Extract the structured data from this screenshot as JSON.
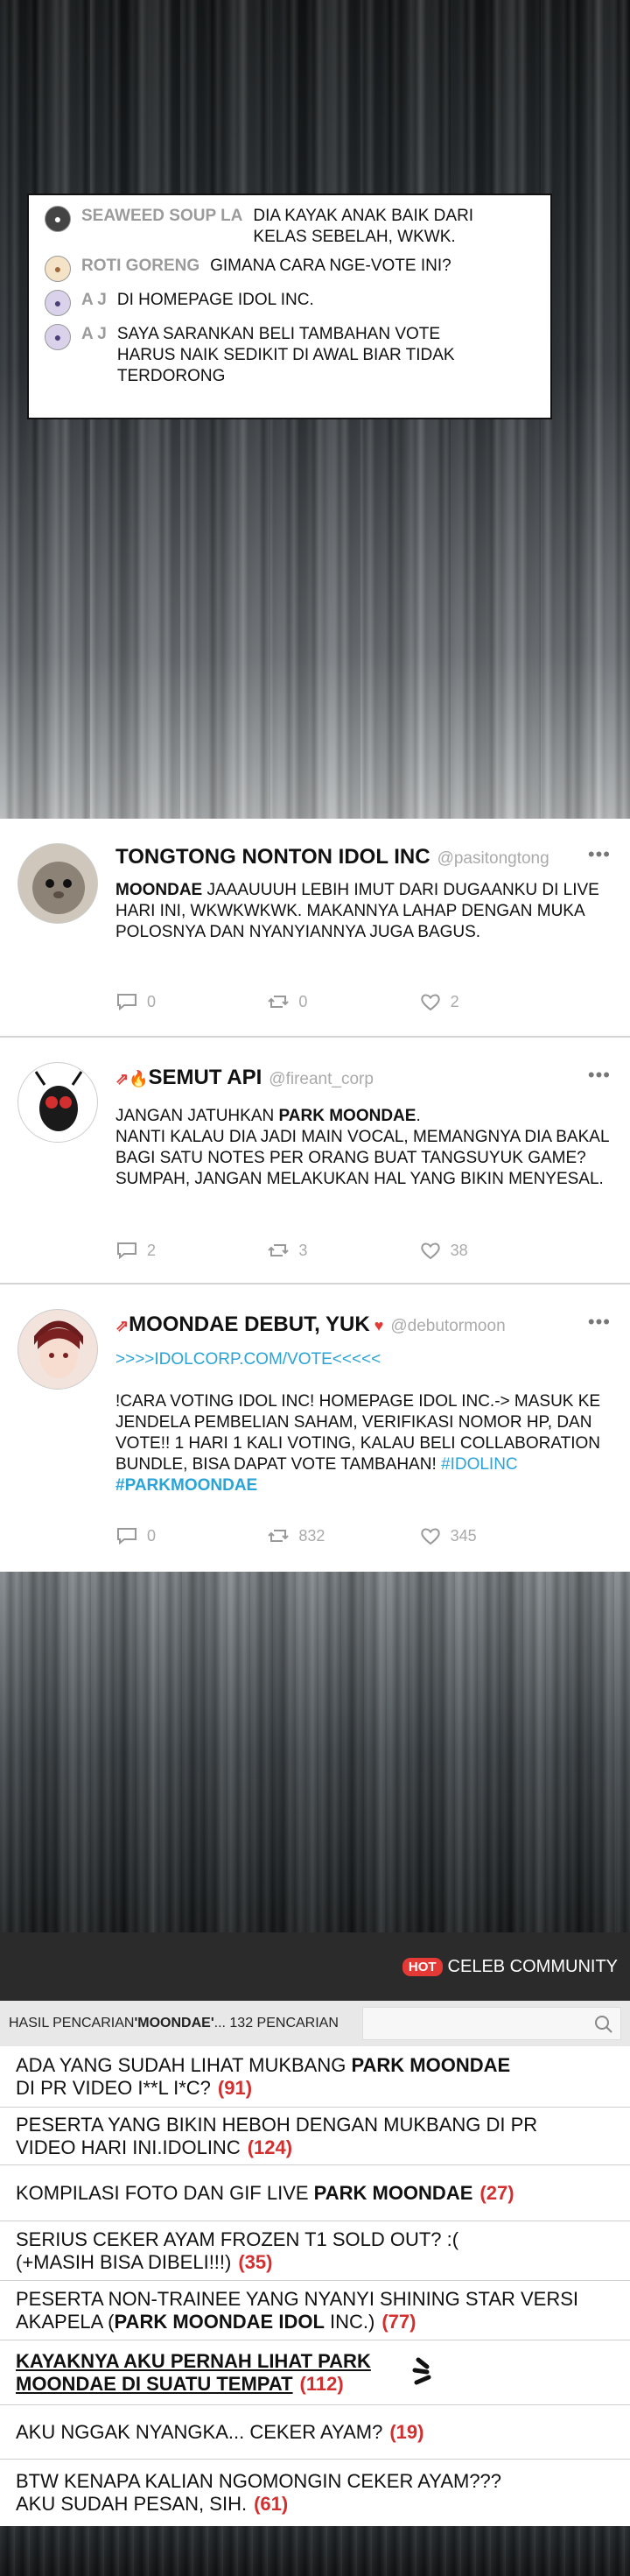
{
  "chat": {
    "messages": [
      {
        "user": "SEAWEED SOUP LA",
        "text": "DIA KAYAK ANAK BAIK DARI KELAS SEBELAH, WKWK."
      },
      {
        "user": "ROTI GORENG",
        "text": "GIMANA CARA NGE-VOTE INI?"
      },
      {
        "user": "A J",
        "text": "DI HOMEPAGE IDOL INC."
      },
      {
        "user": "A J",
        "text": "SAYA SARANKAN BELI TAMBAHAN VOTE HARUS NAIK SEDIKIT DI AWAL BIAR TIDAK TERDORONG"
      }
    ]
  },
  "tweets": [
    {
      "name": "TONGTONG NONTON IDOL INC",
      "handle": "@pasitongtong",
      "body_bold": "MOONDAE",
      "body": " JAAAUUUH LEBIH IMUT DARI DUGAANKU DI LIVE HARI INI, WKWKWKWK. MAKANNYA LAHAP DENGAN MUKA POLOSNYA DAN NYANYIANNYA JUGA BAGUS.",
      "replies": "0",
      "retweets": "0",
      "likes": "2"
    },
    {
      "name": "SEMUT API",
      "handle": "@fireant_corp",
      "body_pre": "JANGAN JATUHKAN ",
      "body_bold": "PARK MOONDAE",
      "body_post": ".",
      "body2": "NANTI KALAU DIA JADI MAIN VOCAL, MEMANGNYA DIA BAKAL BAGI SATU NOTES PER ORANG BUAT TANGSUYUK GAME? SUMPAH, JANGAN MELAKUKAN HAL YANG BIKIN MENYESAL.",
      "replies": "2",
      "retweets": "3",
      "likes": "38"
    },
    {
      "name": "MOONDAE DEBUT, YUK",
      "handle": "@debutormoon",
      "link": ">>>>IDOLCORP.COM/VOTE<<<<<",
      "body": "!CARA VOTING IDOL INC! HOMEPAGE IDOL INC.-> MASUK KE JENDELA PEMBELIAN SAHAM, VERIFIKASI NOMOR HP, DAN VOTE!! 1 HARI 1 KALI VOTING, KALAU BELI COLLABORATION BUNDLE, BISA DAPAT VOTE TAMBAHAN! ",
      "tag1": "#IDOLINC",
      "tag2": "#PARKMOONDAE",
      "replies": "0",
      "retweets": "832",
      "likes": "345"
    }
  ],
  "community": {
    "hot_badge": "HOT",
    "title": "CELEB COMMUNITY",
    "search_prefix": "HASIL PENCARIAN ",
    "search_term": "'MOONDAE'",
    "search_suffix": "... 132 PENCARIAN",
    "posts": [
      {
        "pre": "ADA YANG SUDAH LIHAT MUKBANG ",
        "bold": "PARK MOONDAE",
        "post": " DI PR VIDEO I**L I*C?",
        "count": "(91)"
      },
      {
        "pre": "PESERTA YANG BIKIN HEBOH DENGAN MUKBANG DI PR VIDEO HARI INI.IDOLINC",
        "bold": "",
        "post": "",
        "count": "(124)"
      },
      {
        "pre": "KOMPILASI FOTO DAN GIF LIVE ",
        "bold": "PARK MOONDAE",
        "post": "",
        "count": "(27)"
      },
      {
        "pre": "SERIUS CEKER AYAM FROZEN T1 SOLD OUT? :( (+MASIH BISA DIBELI!!!)",
        "bold": "",
        "post": "",
        "count": "(35)"
      },
      {
        "pre": "PESERTA NON-TRAINEE YANG NYANYI SHINING STAR VERSI AKAPELA (",
        "bold": "PARK MOONDAE IDOL",
        "post": " INC.)",
        "count": "(77)"
      },
      {
        "pre": "KAYAKNYA AKU PERNAH LIHAT PARK MOONDAE DI SUATU TEMPAT",
        "bold": "",
        "post": "",
        "count": "(112)"
      },
      {
        "pre": "AKU NGGAK NYANGKA... CEKER AYAM?",
        "bold": "",
        "post": "",
        "count": "(19)"
      },
      {
        "pre": "BTW KENAPA KALIAN NGOMONGIN CEKER AYAM??? AKU SUDAH PESAN, SIH.",
        "bold": "",
        "post": "",
        "count": "(61)"
      }
    ]
  },
  "colors": {
    "accent": "#2aa3d6",
    "count": "#d32f2f",
    "hot": "#e53935"
  }
}
